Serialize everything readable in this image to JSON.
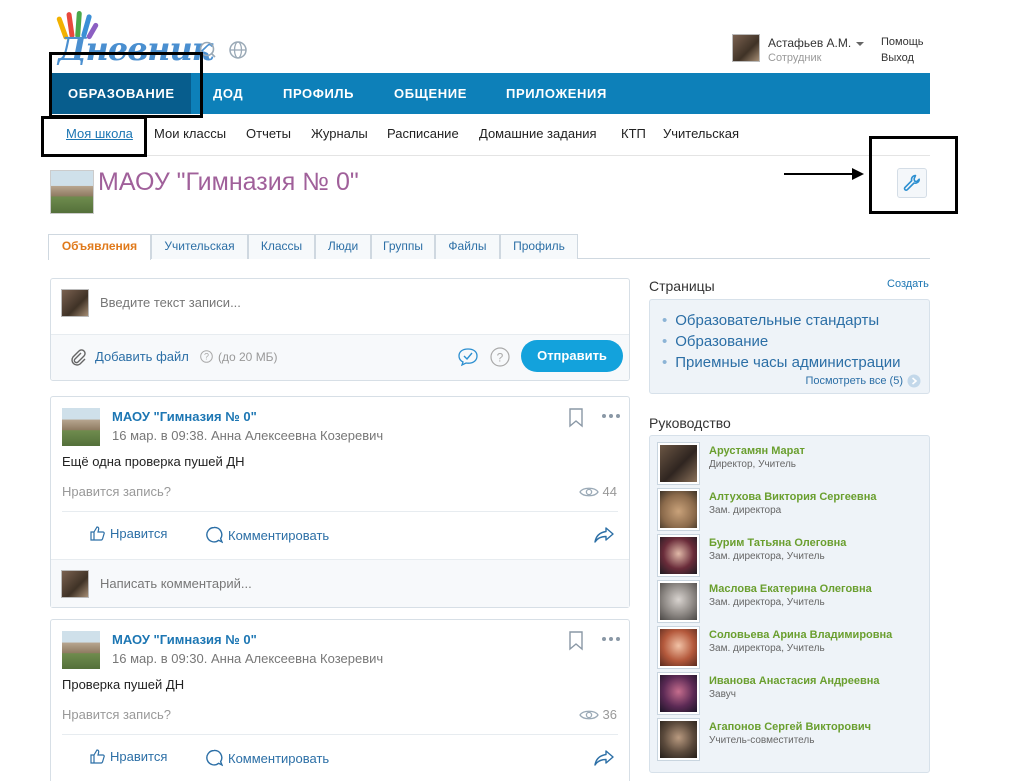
{
  "header": {
    "logo_text": "Дневник",
    "user": {
      "name": "Астафьев А.М.",
      "role": "Сотрудник"
    },
    "help_link": "Помощь",
    "logout_link": "Выход"
  },
  "topnav": {
    "items": [
      "ОБРАЗОВАНИЕ",
      "ДОД",
      "ПРОФИЛЬ",
      "ОБЩЕНИЕ",
      "ПРИЛОЖЕНИЯ"
    ]
  },
  "subnav": {
    "items": [
      "Моя школа",
      "Мои классы",
      "Отчеты",
      "Журналы",
      "Расписание",
      "Домашние задания",
      "КТП",
      "Учительская"
    ]
  },
  "school": {
    "title": "МАОУ \"Гимназия № 0\""
  },
  "tabs": [
    "Объявления",
    "Учительская",
    "Классы",
    "Люди",
    "Группы",
    "Файлы",
    "Профиль"
  ],
  "compose": {
    "placeholder": "Введите текст записи...",
    "attach_label": "Добавить файл",
    "attach_limit": "(до 20 МБ)",
    "send_label": "Отправить"
  },
  "posts": [
    {
      "title": "МАОУ \"Гимназия № 0\"",
      "meta": "16 мар. в 09:38. Анна Алексеевна Козеревич",
      "text": "Ещё одна проверка пушей ДН",
      "like_question": "Нравится запись?",
      "views": "44",
      "like_label": "Нравится",
      "comment_label": "Комментировать",
      "comment_placeholder": "Написать комментарий..."
    },
    {
      "title": "МАОУ \"Гимназия № 0\"",
      "meta": "16 мар. в 09:30. Анна Алексеевна Козеревич",
      "text": "Проверка пушей ДН",
      "like_question": "Нравится запись?",
      "views": "36",
      "like_label": "Нравится",
      "comment_label": "Комментировать"
    }
  ],
  "sidebar": {
    "pages_title": "Страницы",
    "create_link": "Создать",
    "pages": [
      "Образовательные стандарты",
      "Образование",
      "Приемные часы администрации"
    ],
    "view_all": "Посмотреть все (5)",
    "leadership_title": "Руководство",
    "leadership": [
      {
        "name": "Арустамян Марат",
        "role": "Директор, Учитель"
      },
      {
        "name": "Алтухова Виктория Сергеевна",
        "role": "Зам. директора"
      },
      {
        "name": "Бурим Татьяна Олеговна",
        "role": "Зам. директора, Учитель"
      },
      {
        "name": "Маслова Екатерина Олеговна",
        "role": "Зам. директора, Учитель"
      },
      {
        "name": "Соловьева Арина Владимировна",
        "role": "Зам. директора, Учитель"
      },
      {
        "name": "Иванова Анастасия Андреевна",
        "role": "Завуч"
      },
      {
        "name": "Агапонов Сергей Викторович",
        "role": "Учитель-совместитель"
      }
    ]
  },
  "colors": {
    "nav_blue": "#0d80b9",
    "nav_active": "#075d8d",
    "link_blue": "#1c76b3",
    "title_purple": "#a0609a",
    "leader_green": "#6a9f2f",
    "send_button": "#13a2dc"
  }
}
